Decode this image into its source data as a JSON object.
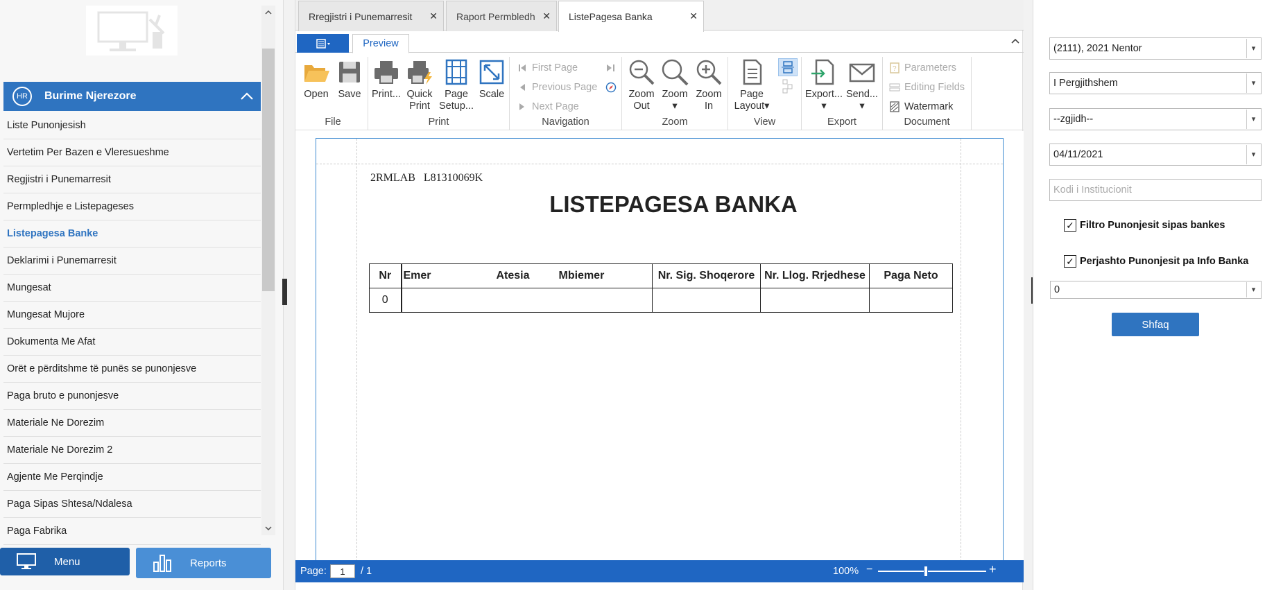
{
  "sidebar": {
    "section_title": "Burime Njerezore",
    "section_badge": "HR",
    "items": [
      "Liste Punonjesish",
      "Vertetim Per Bazen e Vleresueshme",
      "Regjistri i Punemarresit",
      "Permpledhje e Listepageses",
      "Listepagesa Banke",
      "Deklarimi i Punemarresit",
      "Mungesat",
      "Mungesat Mujore",
      "Dokumenta Me Afat",
      "Orët e përditshme të punës se punonjesve",
      "Paga bruto e punonjesve",
      "Materiale Ne Dorezim",
      "Materiale Ne Dorezim 2",
      "Agjente Me Perqindje",
      "Paga Sipas Shtesa/Ndalesa",
      "Paga Fabrika"
    ],
    "active_item": "Listepagesa Banke",
    "menu_button": "Menu",
    "reports_button": "Reports"
  },
  "tabs": [
    {
      "label": "Rregjistri i Punemarresit"
    },
    {
      "label": "Raport Permbledh"
    },
    {
      "label": "ListePagesa Banka"
    }
  ],
  "ribbon": {
    "tab": "Preview",
    "groups": {
      "file": "File",
      "print": "Print",
      "navigation": "Navigation",
      "zoom": "Zoom",
      "view": "View",
      "export": "Export",
      "document": "Document"
    },
    "buttons": {
      "open": "Open",
      "save": "Save",
      "print": "Print...",
      "quick_print_1": "Quick",
      "quick_print_2": "Print",
      "page_setup_1": "Page",
      "page_setup_2": "Setup...",
      "scale": "Scale",
      "first_page": "First Page",
      "previous_page": "Previous Page",
      "next_page": "Next Page",
      "zoom_out_1": "Zoom",
      "zoom_out_2": "Out",
      "zoom": "Zoom",
      "zoom_in_1": "Zoom",
      "zoom_in_2": "In",
      "page_layout_1": "Page",
      "page_layout_2": "Layout",
      "export": "Export...",
      "send": "Send...",
      "parameters": "Parameters",
      "editing_fields": "Editing Fields",
      "watermark": "Watermark"
    }
  },
  "report": {
    "code": "2RMLAB   L81310069K",
    "title": "LISTEPAGESA BANKA",
    "columns": {
      "nr": "Nr",
      "emer": "Emer",
      "atesia": "Atesia",
      "mbiemer": "Mbiemer",
      "sig": "Nr. Sig. Shoqerore",
      "llog": "Nr. Llog. Rrjedhese",
      "paga": "Paga Neto"
    },
    "row_nr": "0"
  },
  "statusbar": {
    "page_label": "Page:",
    "page_value": "1",
    "page_total": "/ 1",
    "zoom": "100%",
    "zoom_level": 0.44
  },
  "filters": {
    "period": "(2111), 2021 Nentor",
    "type": "I Pergjithshem",
    "choose": "--zgjidh--",
    "date": "04/11/2021",
    "institution_placeholder": "Kodi i Institucionit",
    "check1": "Filtro Punonjesit sipas bankes",
    "check2": "Perjashto Punonjesit pa Info Banka",
    "bank_value": "0",
    "show_button": "Shfaq"
  },
  "colors": {
    "accent": "#2f74c0",
    "status_bar": "#1f66c2"
  }
}
